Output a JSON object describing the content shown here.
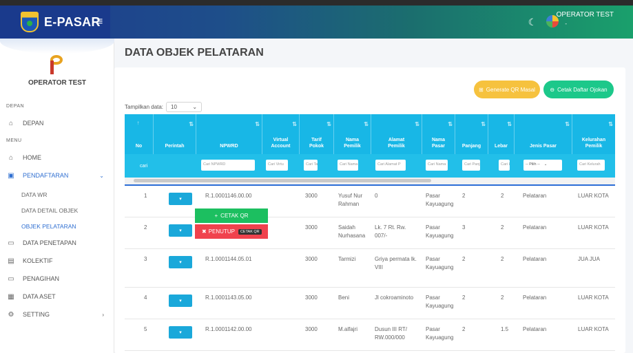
{
  "header": {
    "app_name": "E-PASAR",
    "menu_icon": "hamburger-icon",
    "user_name": "OPERATOR TEST",
    "user_sub": "-",
    "icons": [
      "moon-icon",
      "fullscreen-icon",
      "avatar-icon"
    ]
  },
  "sidebar": {
    "user_name": "OPERATOR TEST",
    "sections": {
      "depan": "DEPAN",
      "menu": "MENU"
    },
    "items": [
      {
        "label": "DEPAN",
        "icon": "home-icon"
      },
      {
        "label": "HOME",
        "icon": "home-icon"
      },
      {
        "label": "PENDAFTARAN",
        "icon": "list-icon",
        "active": true
      },
      {
        "label": "DATA PENETAPAN",
        "icon": "calendar-icon"
      },
      {
        "label": "KOLEKTIF",
        "icon": "card-icon"
      },
      {
        "label": "PENAGIHAN",
        "icon": "calendar-icon"
      },
      {
        "label": "DATA ASET",
        "icon": "document-icon"
      },
      {
        "label": "SETTING",
        "icon": "gear-icon"
      }
    ],
    "sub_items": [
      "DATA WR",
      "DATA DETAIL OBJEK",
      "OBJEK PELATARAN"
    ]
  },
  "page": {
    "title": "DATA OBJEK PELATARAN",
    "btn_generate_qr": "Generate QR Masal",
    "btn_print": "Cetak Daftar Ojokan",
    "show_label": "Tampilkan data:",
    "show_value": "10"
  },
  "table": {
    "columns": [
      "No",
      "Perintah",
      "NPWRD",
      "Virtual Account",
      "Tarif Pokok",
      "Nama Pemilik",
      "Alamat Pemilik",
      "Nama Pasar",
      "Panjang",
      "Lebar",
      "Jenis Pasar",
      "Kelurahan Pemilik"
    ],
    "filters": {
      "cari": "cari",
      "npwrd": "Cari NPWRD",
      "va": "Cari Virtu",
      "tarif": "Cari Ta",
      "nama": "Cari Nama",
      "alamat": "Cari Alamat P",
      "pasar": "Cari Nama",
      "panjang": "Cari Panj",
      "lebar": "Cari Le",
      "jenis": "-- Pilih --",
      "kelurahan": "Cari Kelurah"
    },
    "rows": [
      {
        "no": "1",
        "npwrd": "R.1.0001146.00.00",
        "va": "",
        "tarif": "3000",
        "nama": "Yusuf Nur Rahman",
        "alamat": "0",
        "pasar": "Pasar Kayuagung",
        "panjang": "2",
        "lebar": "2",
        "jenis": "Pelataran",
        "kelurahan": "LUAR KOTA"
      },
      {
        "no": "2",
        "npwrd": "",
        "va": "",
        "tarif": "3000",
        "nama": "Saidah Nurhasana",
        "alamat": "Lk. 7 Rt. Rw. 007/-",
        "pasar": "Pasar Kayuagung",
        "panjang": "3",
        "lebar": "2",
        "jenis": "Pelataran",
        "kelurahan": "LUAR KOTA"
      },
      {
        "no": "3",
        "npwrd": "R.1.0001144.05.01",
        "va": "",
        "tarif": "3000",
        "nama": "Tarmizi",
        "alamat": "Griya permata lk. VIII",
        "pasar": "Pasar Kayuagung",
        "panjang": "2",
        "lebar": "2",
        "jenis": "Pelataran",
        "kelurahan": "JUA JUA"
      },
      {
        "no": "4",
        "npwrd": "R.1.0001143.05.00",
        "va": "",
        "tarif": "3000",
        "nama": "Beni",
        "alamat": "Jl cokroaminoto",
        "pasar": "Pasar Kayuagung",
        "panjang": "2",
        "lebar": "2",
        "jenis": "Pelataran",
        "kelurahan": "LUAR KOTA"
      },
      {
        "no": "5",
        "npwrd": "R.1.0001142.00.00",
        "va": "",
        "tarif": "3000",
        "nama": "M.alfajri",
        "alamat": "Dusun III RT/ RW.000/000",
        "pasar": "Pasar Kayuagung",
        "panjang": "2",
        "lebar": "1.5",
        "jenis": "Pelataran",
        "kelurahan": "LUAR KOTA"
      }
    ],
    "action_caret": "▾"
  },
  "dropdown": {
    "cetak_label": "CETAK QR",
    "tutup_label": "PENUTUP",
    "tooltip": "CETAK QR"
  }
}
